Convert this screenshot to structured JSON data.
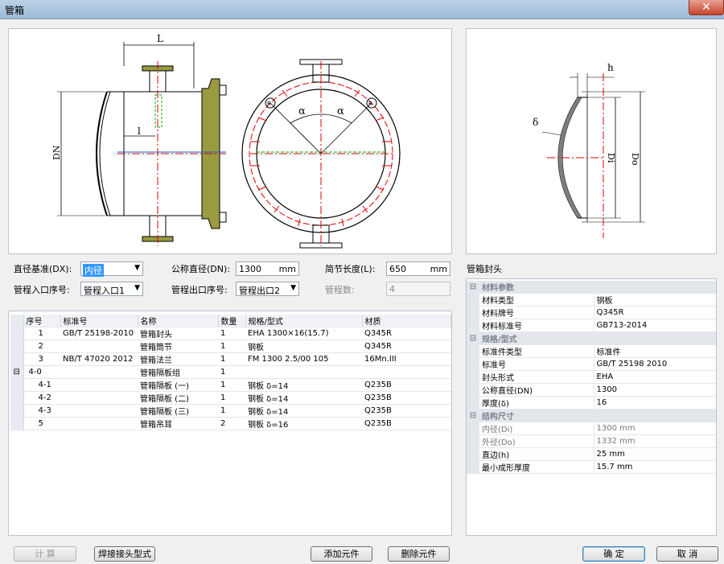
{
  "window": {
    "title": "管箱",
    "close_glyph": "✕"
  },
  "drawing_labels": {
    "L": "L",
    "l": "l",
    "DN": "DN",
    "alpha": "α",
    "R": "R",
    "h": "h",
    "delta": "δ",
    "Di": "Di",
    "Do": "Do"
  },
  "params": {
    "diameter_basis_label": "直径基准(DX):",
    "diameter_basis_value": "内径",
    "nominal_diameter_label": "公称直径(DN):",
    "nominal_diameter_value": "1300",
    "nominal_diameter_unit": "mm",
    "section_length_label": "简节长度(L):",
    "section_length_value": "650",
    "section_length_unit": "mm",
    "inlet_index_label": "管程入口序号:",
    "inlet_index_value": "管程入口1",
    "outlet_index_label": "管程出口序号:",
    "outlet_index_value": "管程出口2",
    "pass_count_label": "管程数:",
    "pass_count_value": "4"
  },
  "parts_table": {
    "headers": [
      "序号",
      "标准号",
      "名称",
      "数量",
      "规格/型式",
      "材质"
    ],
    "rows": [
      {
        "gutter": "",
        "no": "1",
        "std": "GB/T 25198-2010",
        "name": "管箱封头",
        "qty": "1",
        "spec": "EHA 1300×16(15.7)",
        "mat": "Q345R"
      },
      {
        "gutter": "",
        "no": "2",
        "std": "",
        "name": "管箱筒节",
        "qty": "1",
        "spec": "钢板",
        "mat": "Q345R"
      },
      {
        "gutter": "",
        "no": "3",
        "std": "NB/T 47020 2012",
        "name": "管箱法兰",
        "qty": "1",
        "spec": "FM 1300 2.5/00 105",
        "mat": "16Mn.III"
      },
      {
        "gutter": "⊟",
        "no": "4-0",
        "std": "",
        "name": "管箱隔板组",
        "qty": "1",
        "spec": "",
        "mat": ""
      },
      {
        "gutter": "",
        "no": "4-1",
        "std": "",
        "name": "管箱隔板 (一)",
        "qty": "1",
        "spec": "钢板 δ=14",
        "mat": "Q235B"
      },
      {
        "gutter": "",
        "no": "4-2",
        "std": "",
        "name": "管箱隔板 (二)",
        "qty": "1",
        "spec": "钢板 δ=14",
        "mat": "Q235B"
      },
      {
        "gutter": "",
        "no": "4-3",
        "std": "",
        "name": "管箱隔板 (三)",
        "qty": "1",
        "spec": "钢板 δ=14",
        "mat": "Q235B"
      },
      {
        "gutter": "",
        "no": "5",
        "std": "",
        "name": "管箱吊耳",
        "qty": "2",
        "spec": "钢板 δ=16",
        "mat": "Q235B"
      }
    ]
  },
  "head_section": {
    "title": "管箱封头"
  },
  "properties": {
    "groups": [
      {
        "toggle": "⊟",
        "name": "材料参数",
        "items": [
          {
            "k": "材料类型",
            "v": "钢板"
          },
          {
            "k": "材料牌号",
            "v": "Q345R"
          },
          {
            "k": "材料标准号",
            "v": "GB713-2014"
          }
        ]
      },
      {
        "toggle": "⊟",
        "name": "规格/型式",
        "items": [
          {
            "k": "标准件类型",
            "v": "标准件"
          },
          {
            "k": "标准号",
            "v": "GB/T 25198 2010"
          },
          {
            "k": "封头形式",
            "v": "EHA"
          },
          {
            "k": "公称直径(DN)",
            "v": "1300"
          },
          {
            "k": "厚度(δ)",
            "v": "16"
          }
        ]
      },
      {
        "toggle": "⊟",
        "name": "结构尺寸",
        "items": [
          {
            "k": "内径(Di)",
            "v": "1300  mm",
            "grey": true
          },
          {
            "k": "外径(Do)",
            "v": "1332  mm",
            "grey": true
          },
          {
            "k": "直边(h)",
            "v": "25  mm",
            "grey": false
          },
          {
            "k": "最小成形厚度",
            "v": "15.7  mm",
            "grey": false
          }
        ]
      }
    ]
  },
  "buttons": {
    "calc": "计 算",
    "weld": "焊接接头型式",
    "add": "添加元件",
    "delete": "删除元件",
    "ok": "确 定",
    "cancel": "取 消"
  },
  "colors": {
    "accent": "#3399ff",
    "centerline": "#e00000",
    "hidden_line": "#00b000",
    "flange_fill": "#9a9a40"
  }
}
